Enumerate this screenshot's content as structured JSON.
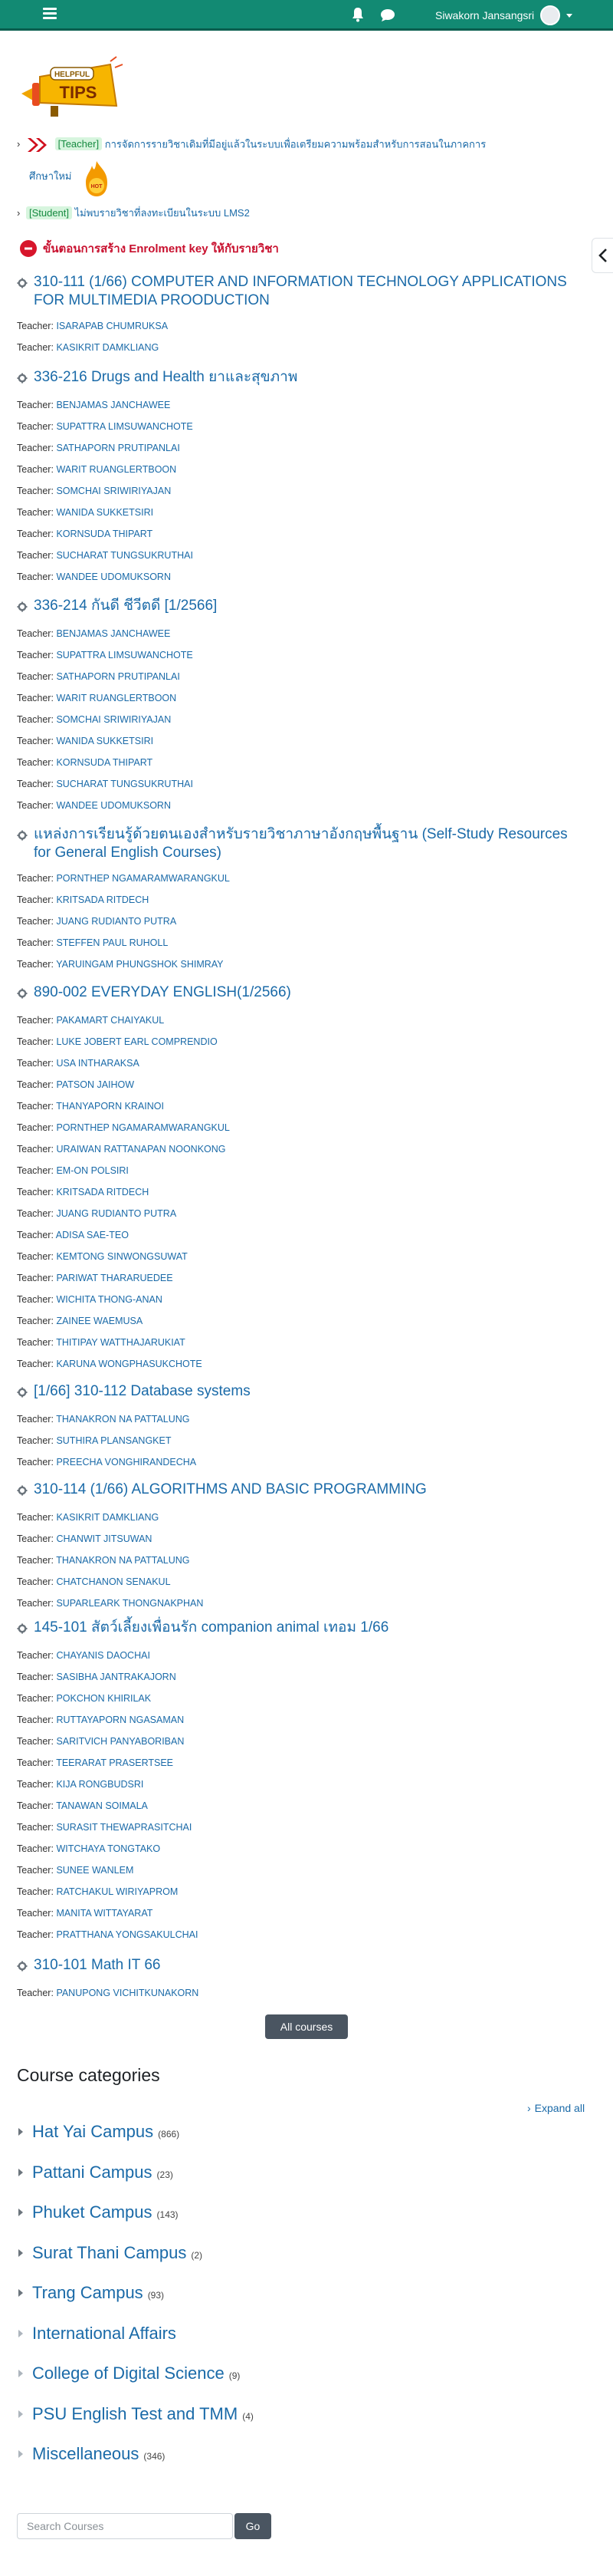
{
  "navbar": {
    "user_name": "Siwakorn Jansangsri"
  },
  "tips": {
    "logo_text_top": "HELPFUL",
    "logo_text_bottom": "TIPS",
    "notice1": {
      "badge": "[Teacher]",
      "text_line1": "การจัดการรายวิชาเดิมที่มีอยู่แล้วในระบบเพื่อเตรียมความพร้อมสำหรับการสอนในภาคการ",
      "text_line2": "ศึกษาใหม่",
      "hot_label": "HOT"
    },
    "notice2": {
      "badge": "[Student]",
      "text": "ไม่พบรายวิชาที่ลงทะเบียนในระบบ LMS2"
    },
    "enrol_text": "ขั้นตอนการสร้าง Enrolment key ให้กับรายวิชา"
  },
  "teacher_label": "Teacher:",
  "courses": [
    {
      "title": [
        "310-111 (1/66) COMPUTER AND INFORMATION TECHNOLOGY APPLICATIONS",
        "FOR MULTIMEDIA PROODUCTION"
      ],
      "teachers": [
        "ISARAPAB CHUMRUKSA",
        "KASIKRIT DAMKLIANG"
      ]
    },
    {
      "title": [
        "336-216 Drugs and Health ยาและสุขภาพ"
      ],
      "teachers": [
        "BENJAMAS JANCHAWEE",
        "SUPATTRA LIMSUWANCHOTE",
        "SATHAPORN PRUTIPANLAI",
        "WARIT RUANGLERTBOON",
        "SOMCHAI SRIWIRIYAJAN",
        "WANIDA SUKKETSIRI",
        "KORNSUDA THIPART",
        "SUCHARAT TUNGSUKRUTHAI",
        "WANDEE UDOMUKSORN"
      ]
    },
    {
      "title": [
        "336-214 กันดี ชีวีตดี [1/2566]"
      ],
      "teachers": [
        "BENJAMAS JANCHAWEE",
        "SUPATTRA LIMSUWANCHOTE",
        "SATHAPORN PRUTIPANLAI",
        "WARIT RUANGLERTBOON",
        "SOMCHAI SRIWIRIYAJAN",
        "WANIDA SUKKETSIRI",
        "KORNSUDA THIPART",
        "SUCHARAT TUNGSUKRUTHAI",
        "WANDEE UDOMUKSORN"
      ]
    },
    {
      "title": [
        "แหล่งการเรียนรู้ด้วยตนเองสำหรับรายวิชาภาษาอังกฤษพื้นฐาน (Self-Study Resources",
        "for General English Courses)"
      ],
      "teachers": [
        "PORNTHEP NGAMARAMWARANGKUL",
        "KRITSADA RITDECH",
        "JUANG RUDIANTO PUTRA",
        "STEFFEN PAUL RUHOLL",
        "YARUINGAM PHUNGSHOK SHIMRAY"
      ]
    },
    {
      "title": [
        "890-002 EVERYDAY ENGLISH(1/2566)"
      ],
      "teachers": [
        "PAKAMART CHAIYAKUL",
        "LUKE JOBERT EARL COMPRENDIO",
        "USA INTHARAKSA",
        "PATSON JAIHOW",
        "THANYAPORN KRAINOI",
        "PORNTHEP NGAMARAMWARANGKUL",
        "URAIWAN RATTANAPAN NOONKONG",
        "EM-ON POLSIRI",
        "KRITSADA RITDECH",
        "JUANG RUDIANTO PUTRA",
        "ADISA SAE-TEO",
        "KEMTONG SINWONGSUWAT",
        "PARIWAT THARARUEDEE",
        "WICHITA THONG-ANAN",
        "ZAINEE WAEMUSA",
        "THITIPAY WATTHAJARUKIAT",
        "KARUNA WONGPHASUKCHOTE"
      ]
    },
    {
      "title": [
        "[1/66] 310-112 Database systems"
      ],
      "teachers": [
        "THANAKRON NA PATTALUNG",
        "SUTHIRA PLANSANGKET",
        "PREECHA VONGHIRANDECHA"
      ]
    },
    {
      "title": [
        "310-114 (1/66) ALGORITHMS AND BASIC PROGRAMMING"
      ],
      "teachers": [
        "KASIKRIT DAMKLIANG",
        "CHANWIT JITSUWAN",
        "THANAKRON NA PATTALUNG",
        "CHATCHANON SENAKUL",
        "SUPARLEARK THONGNAKPHAN"
      ]
    },
    {
      "title": [
        "145-101 สัตว์เลี้ยงเพื่อนรัก companion animal เทอม 1/66"
      ],
      "teachers": [
        "CHAYANIS DAOCHAI",
        "SASIBHA JANTRAKAJORN",
        "POKCHON KHIRILAK",
        "RUTTAYAPORN NGASAMAN",
        "SARITVICH PANYABORIBAN",
        "TEERARAT PRASERTSEE",
        "KIJA RONGBUDSRI",
        "TANAWAN SOIMALA",
        "SURASIT THEWAPRASITCHAI",
        "WITCHAYA TONGTAKO",
        "SUNEE WANLEM",
        "RATCHAKUL WIRIYAPROM",
        "MANITA WITTAYARAT",
        "PRATTHANA YONGSAKULCHAI"
      ]
    },
    {
      "title": [
        "310-101 Math IT 66"
      ],
      "teachers": [
        "PANUPONG VICHITKUNAKORN"
      ]
    }
  ],
  "all_courses_label": "All courses",
  "categories": {
    "heading": "Course categories",
    "expand_all": "Expand all",
    "items": [
      {
        "name": "Hat Yai Campus",
        "count": "(866)",
        "expandable": true
      },
      {
        "name": "Pattani Campus",
        "count": "(23)",
        "expandable": true
      },
      {
        "name": "Phuket Campus",
        "count": "(143)",
        "expandable": true
      },
      {
        "name": "Surat Thani Campus",
        "count": "(2)",
        "expandable": true
      },
      {
        "name": "Trang Campus",
        "count": "(93)",
        "expandable": true
      },
      {
        "name": "International Affairs",
        "count": "",
        "expandable": false
      },
      {
        "name": "College of Digital Science",
        "count": "(9)",
        "expandable": false
      },
      {
        "name": "PSU English Test and TMM",
        "count": "(4)",
        "expandable": false
      },
      {
        "name": "Miscellaneous",
        "count": "(346)",
        "expandable": false
      }
    ]
  },
  "search": {
    "placeholder": "Search Courses",
    "button_label": "Go"
  }
}
